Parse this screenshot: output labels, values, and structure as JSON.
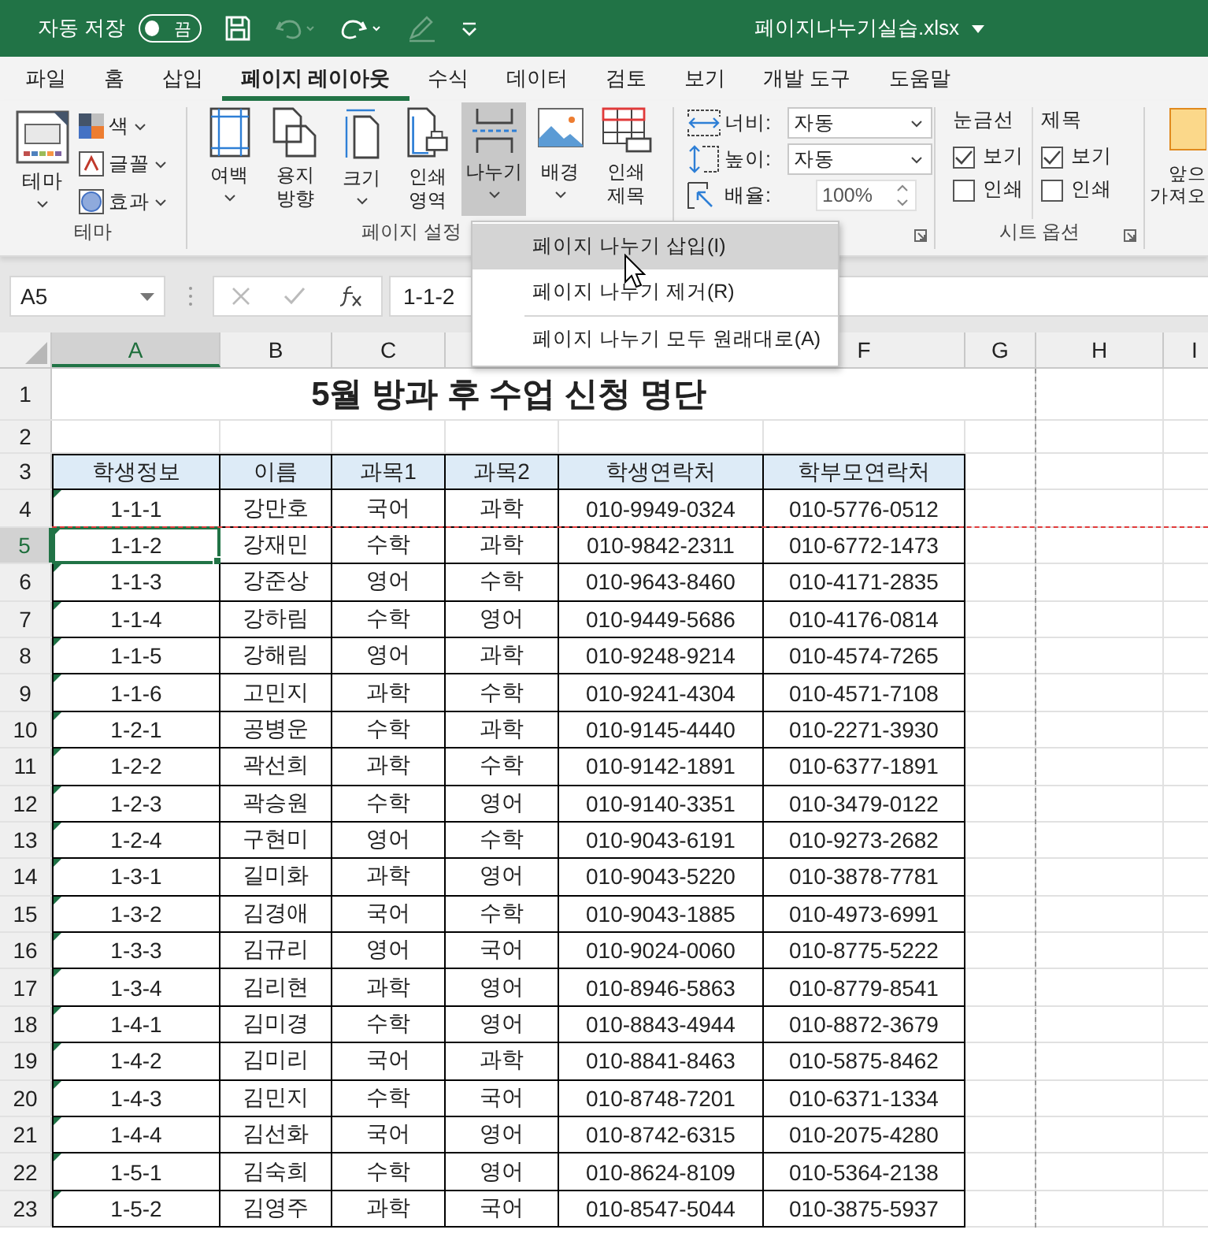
{
  "title_bar": {
    "autosave_label": "자동 저장",
    "autosave": {
      "label": "끔",
      "on": false
    },
    "filename": "페이지나누기실습.xlsx"
  },
  "ribbon_tabs": [
    {
      "label": "파일",
      "selected": false
    },
    {
      "label": "홈",
      "selected": false
    },
    {
      "label": "삽입",
      "selected": false
    },
    {
      "label": "페이지 레이아웃",
      "selected": true
    },
    {
      "label": "수식",
      "selected": false
    },
    {
      "label": "데이터",
      "selected": false
    },
    {
      "label": "검토",
      "selected": false
    },
    {
      "label": "보기",
      "selected": false
    },
    {
      "label": "개발 도구",
      "selected": false
    },
    {
      "label": "도움말",
      "selected": false
    }
  ],
  "ribbon": {
    "theme": {
      "button": "테마",
      "items": [
        {
          "label": "색",
          "kind": "colors"
        },
        {
          "label": "글꼴",
          "kind": "fonts"
        },
        {
          "label": "효과",
          "kind": "effects"
        }
      ],
      "label": "테마"
    },
    "page_setup": {
      "buttons": [
        {
          "lines": [
            "여백"
          ],
          "kind": "margins",
          "selected": false
        },
        {
          "lines": [
            "용지",
            "방향"
          ],
          "kind": "orientation",
          "selected": false
        },
        {
          "lines": [
            "크기"
          ],
          "kind": "size",
          "selected": false
        },
        {
          "lines": [
            "인쇄",
            "영역"
          ],
          "kind": "print_area",
          "selected": false
        },
        {
          "lines": [
            "나누기"
          ],
          "kind": "breaks",
          "selected": true
        },
        {
          "lines": [
            "배경"
          ],
          "kind": "background",
          "selected": false
        },
        {
          "lines": [
            "인쇄",
            "제목"
          ],
          "kind": "print_titles",
          "selected": false
        }
      ],
      "label": "페이지 설정"
    },
    "scale": {
      "fields": [
        {
          "label": "너비:",
          "value": "자동",
          "kind": "width"
        },
        {
          "label": "높이:",
          "value": "자동",
          "kind": "height"
        }
      ],
      "zoom": {
        "label": "배율:",
        "value": "100%"
      }
    },
    "sheet_options": {
      "columns": [
        {
          "title": "눈금선",
          "options": [
            {
              "label": "보기",
              "checked": true
            },
            {
              "label": "인쇄",
              "checked": false
            }
          ]
        },
        {
          "title": "제목",
          "options": [
            {
              "label": "보기",
              "checked": true
            },
            {
              "label": "인쇄",
              "checked": false
            }
          ]
        }
      ],
      "label": "시트 옵션"
    },
    "arrange": {
      "lines": [
        "앞으",
        "가져오"
      ]
    }
  },
  "dropdown_menu": [
    {
      "label": "페이지 나누기 삽입(I)",
      "selected": true,
      "divider_above": false
    },
    {
      "label": "페이지 나누기 제거(R)",
      "selected": false,
      "divider_above": false
    },
    {
      "label": "페이지 나누기 모두 원래대로(A)",
      "selected": false,
      "divider_above": true
    }
  ],
  "formula_bar": {
    "name_box": "A5",
    "formula": "1-1-2"
  },
  "sheet": {
    "columns": [
      {
        "kind": "label",
        "label": "A",
        "selected": true,
        "page_break_after": false
      },
      {
        "kind": "label",
        "label": "B",
        "selected": false,
        "page_break_after": false
      },
      {
        "kind": "label",
        "label": "C",
        "selected": false,
        "page_break_after": false
      },
      {
        "kind": "covered"
      },
      {
        "kind": "covered"
      },
      {
        "kind": "label",
        "label": "F",
        "selected": false,
        "page_break_after": false
      },
      {
        "kind": "label",
        "label": "G",
        "selected": false,
        "page_break_after": true
      },
      {
        "kind": "label",
        "label": "H",
        "selected": false,
        "page_break_after": false
      },
      {
        "kind": "label",
        "label": "I",
        "selected": false,
        "page_break_after": false
      }
    ],
    "rows": [
      {
        "number": "1",
        "kind": "title",
        "cells": [
          "5월 방과 후 수업 신청 명단"
        ],
        "active": false,
        "flagged": false,
        "page_break_after": false
      },
      {
        "number": "2",
        "kind": "blank",
        "active": false,
        "flagged": false,
        "page_break_after": false
      },
      {
        "number": "3",
        "kind": "header",
        "cells": [
          "학생정보",
          "이름",
          "과목1",
          "과목2",
          "학생연락처",
          "학부모연락처"
        ],
        "active": false,
        "flagged": false,
        "page_break_after": false
      },
      {
        "number": "4",
        "kind": "data",
        "cells": [
          "1-1-1",
          "강만호",
          "국어",
          "과학",
          "010-9949-0324",
          "010-5776-0512"
        ],
        "active": false,
        "flagged": true,
        "page_break_after": true
      },
      {
        "number": "5",
        "kind": "data",
        "cells": [
          "1-1-2",
          "강재민",
          "수학",
          "과학",
          "010-9842-2311",
          "010-6772-1473"
        ],
        "active": true,
        "flagged": true,
        "page_break_after": false
      },
      {
        "number": "6",
        "kind": "data",
        "cells": [
          "1-1-3",
          "강준상",
          "영어",
          "수학",
          "010-9643-8460",
          "010-4171-2835"
        ],
        "active": false,
        "flagged": true,
        "page_break_after": false
      },
      {
        "number": "7",
        "kind": "data",
        "cells": [
          "1-1-4",
          "강하림",
          "수학",
          "영어",
          "010-9449-5686",
          "010-4176-0814"
        ],
        "active": false,
        "flagged": true,
        "page_break_after": false
      },
      {
        "number": "8",
        "kind": "data",
        "cells": [
          "1-1-5",
          "강해림",
          "영어",
          "과학",
          "010-9248-9214",
          "010-4574-7265"
        ],
        "active": false,
        "flagged": true,
        "page_break_after": false
      },
      {
        "number": "9",
        "kind": "data",
        "cells": [
          "1-1-6",
          "고민지",
          "과학",
          "수학",
          "010-9241-4304",
          "010-4571-7108"
        ],
        "active": false,
        "flagged": true,
        "page_break_after": false
      },
      {
        "number": "10",
        "kind": "data",
        "cells": [
          "1-2-1",
          "공병운",
          "수학",
          "과학",
          "010-9145-4440",
          "010-2271-3930"
        ],
        "active": false,
        "flagged": true,
        "page_break_after": false
      },
      {
        "number": "11",
        "kind": "data",
        "cells": [
          "1-2-2",
          "곽선희",
          "과학",
          "수학",
          "010-9142-1891",
          "010-6377-1891"
        ],
        "active": false,
        "flagged": true,
        "page_break_after": false
      },
      {
        "number": "12",
        "kind": "data",
        "cells": [
          "1-2-3",
          "곽승원",
          "수학",
          "영어",
          "010-9140-3351",
          "010-3479-0122"
        ],
        "active": false,
        "flagged": true,
        "page_break_after": false
      },
      {
        "number": "13",
        "kind": "data",
        "cells": [
          "1-2-4",
          "구현미",
          "영어",
          "수학",
          "010-9043-6191",
          "010-9273-2682"
        ],
        "active": false,
        "flagged": true,
        "page_break_after": false
      },
      {
        "number": "14",
        "kind": "data",
        "cells": [
          "1-3-1",
          "길미화",
          "과학",
          "영어",
          "010-9043-5220",
          "010-3878-7781"
        ],
        "active": false,
        "flagged": true,
        "page_break_after": false
      },
      {
        "number": "15",
        "kind": "data",
        "cells": [
          "1-3-2",
          "김경애",
          "국어",
          "수학",
          "010-9043-1885",
          "010-4973-6991"
        ],
        "active": false,
        "flagged": true,
        "page_break_after": false
      },
      {
        "number": "16",
        "kind": "data",
        "cells": [
          "1-3-3",
          "김규리",
          "영어",
          "국어",
          "010-9024-0060",
          "010-8775-5222"
        ],
        "active": false,
        "flagged": true,
        "page_break_after": false
      },
      {
        "number": "17",
        "kind": "data",
        "cells": [
          "1-3-4",
          "김리현",
          "과학",
          "영어",
          "010-8946-5863",
          "010-8779-8541"
        ],
        "active": false,
        "flagged": true,
        "page_break_after": false
      },
      {
        "number": "18",
        "kind": "data",
        "cells": [
          "1-4-1",
          "김미경",
          "수학",
          "영어",
          "010-8843-4944",
          "010-8872-3679"
        ],
        "active": false,
        "flagged": true,
        "page_break_after": false
      },
      {
        "number": "19",
        "kind": "data",
        "cells": [
          "1-4-2",
          "김미리",
          "국어",
          "과학",
          "010-8841-8463",
          "010-5875-8462"
        ],
        "active": false,
        "flagged": true,
        "page_break_after": false
      },
      {
        "number": "20",
        "kind": "data",
        "cells": [
          "1-4-3",
          "김민지",
          "수학",
          "국어",
          "010-8748-7201",
          "010-6371-1334"
        ],
        "active": false,
        "flagged": true,
        "page_break_after": false
      },
      {
        "number": "21",
        "kind": "data",
        "cells": [
          "1-4-4",
          "김선화",
          "국어",
          "영어",
          "010-8742-6315",
          "010-2075-4280"
        ],
        "active": false,
        "flagged": true,
        "page_break_after": false
      },
      {
        "number": "22",
        "kind": "data",
        "cells": [
          "1-5-1",
          "김숙희",
          "수학",
          "영어",
          "010-8624-8109",
          "010-5364-2138"
        ],
        "active": false,
        "flagged": true,
        "page_break_after": false
      },
      {
        "number": "23",
        "kind": "data",
        "cells": [
          "1-5-2",
          "김영주",
          "과학",
          "국어",
          "010-8547-5044",
          "010-3875-5937"
        ],
        "active": false,
        "flagged": true,
        "page_break_after": false
      }
    ]
  }
}
